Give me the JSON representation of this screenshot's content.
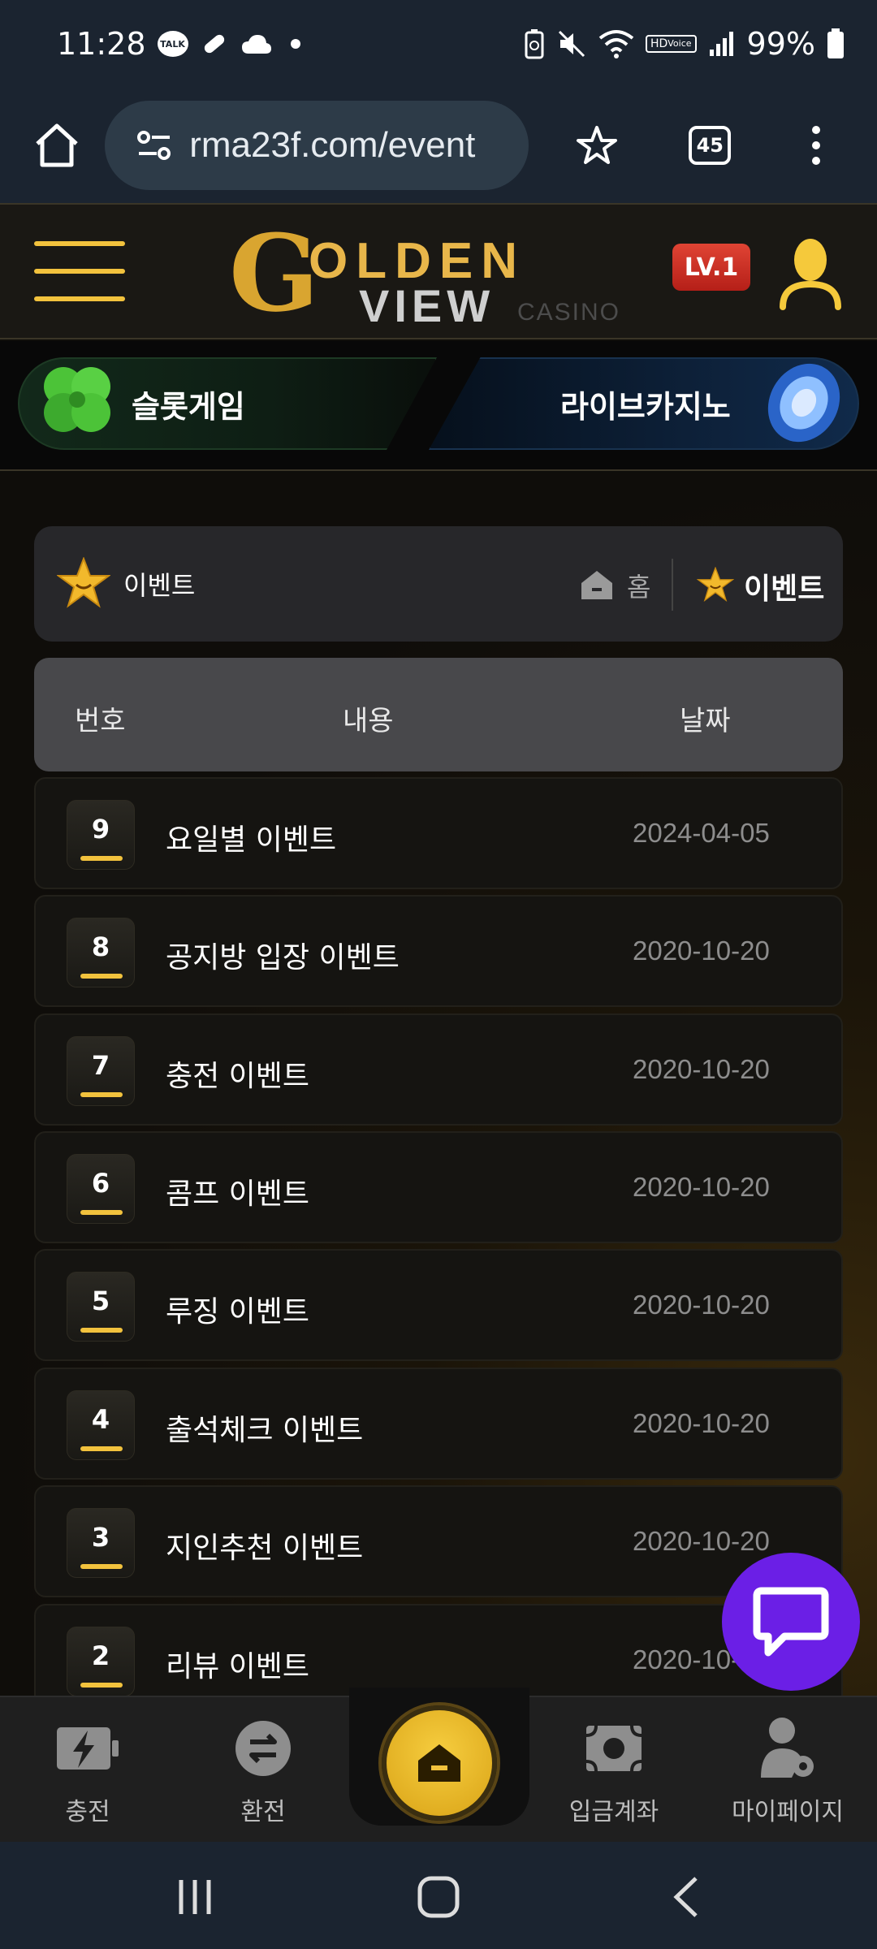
{
  "status_bar": {
    "time": "11:28",
    "talk_badge": "TALK",
    "hd_badge": "HD",
    "voice": "Voice",
    "battery": "99%"
  },
  "browser": {
    "url": "rma23f.com/event",
    "tab_count": "45"
  },
  "header": {
    "logo": {
      "g": "G",
      "golden": "OLDEN",
      "view": "VIEW",
      "casino": "CASINO"
    },
    "level_badge": "LV.1"
  },
  "banners": {
    "slot": "슬롯게임",
    "live": "라이브카지노"
  },
  "breadcrumb": {
    "page_title": "이벤트",
    "home": "홈",
    "current": "이벤트"
  },
  "table": {
    "headers": {
      "number": "번호",
      "content": "내용",
      "date": "날짜"
    },
    "rows": [
      {
        "num": "9",
        "title": "요일별 이벤트",
        "date": "2024-04-05"
      },
      {
        "num": "8",
        "title": "공지방 입장 이벤트",
        "date": "2020-10-20"
      },
      {
        "num": "7",
        "title": "충전 이벤트",
        "date": "2020-10-20"
      },
      {
        "num": "6",
        "title": "콤프 이벤트",
        "date": "2020-10-20"
      },
      {
        "num": "5",
        "title": "루징 이벤트",
        "date": "2020-10-20"
      },
      {
        "num": "4",
        "title": "출석체크 이벤트",
        "date": "2020-10-20"
      },
      {
        "num": "3",
        "title": "지인추천 이벤트",
        "date": "2020-10-20"
      },
      {
        "num": "2",
        "title": "리뷰 이벤트",
        "date": "2020-10-20"
      }
    ]
  },
  "bottom_nav": {
    "charge": "충전",
    "exchange": "환전",
    "deposit_account": "입금계좌",
    "mypage": "마이페이지"
  },
  "colors": {
    "accent_gold": "#f2c23d",
    "chat_purple": "#6b1fe6",
    "level_red": "#d2332a"
  }
}
